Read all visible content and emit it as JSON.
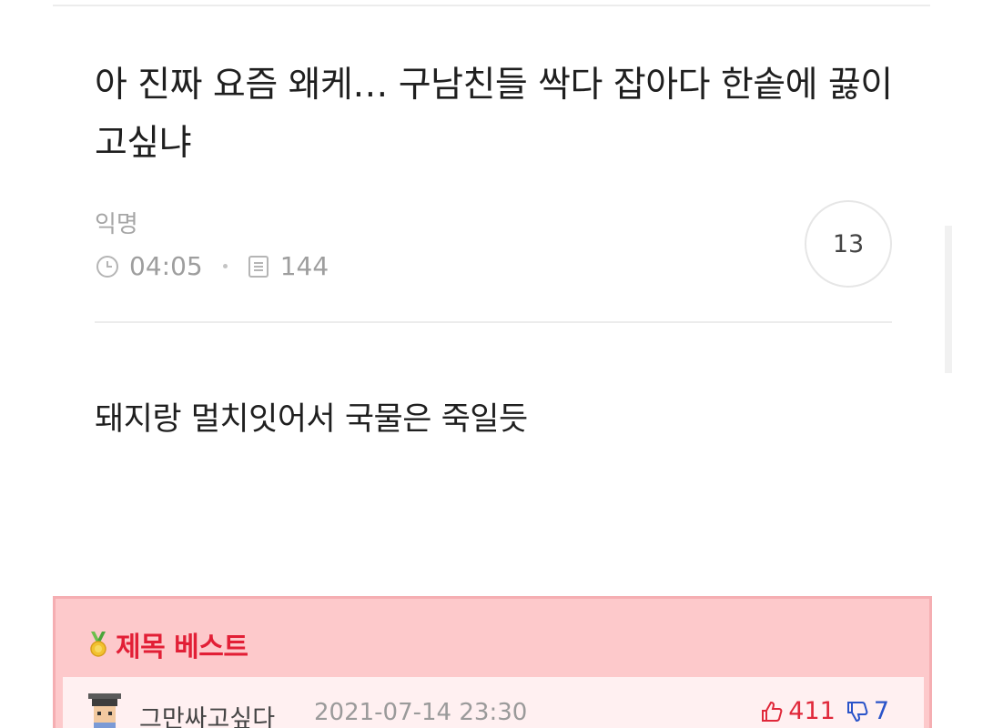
{
  "post": {
    "title": "아 진짜 요즘 왜케… 구남친들 싹다 잡아다 한솥에 끓이고싶냐",
    "author": "익명",
    "time": "04:05",
    "views": "144",
    "comment_count": "13",
    "body": "돼지랑 멀치잇어서 국물은 죽일듯"
  },
  "best": {
    "header": "제목 베스트",
    "items": [
      {
        "nickname": "그만싸고싶다",
        "date": "2021-07-14 23:30",
        "likes": "411",
        "dislikes": "7"
      }
    ]
  },
  "icons": {
    "clock": "clock-icon",
    "views": "document-icon",
    "medal": "medal-icon",
    "thumbs_up": "thumbs-up-icon",
    "thumbs_down": "thumbs-down-icon"
  },
  "colors": {
    "best_bg": "#fdc9cb",
    "best_header": "#e21f36",
    "like": "#e0283a",
    "dislike": "#2a54c9"
  }
}
